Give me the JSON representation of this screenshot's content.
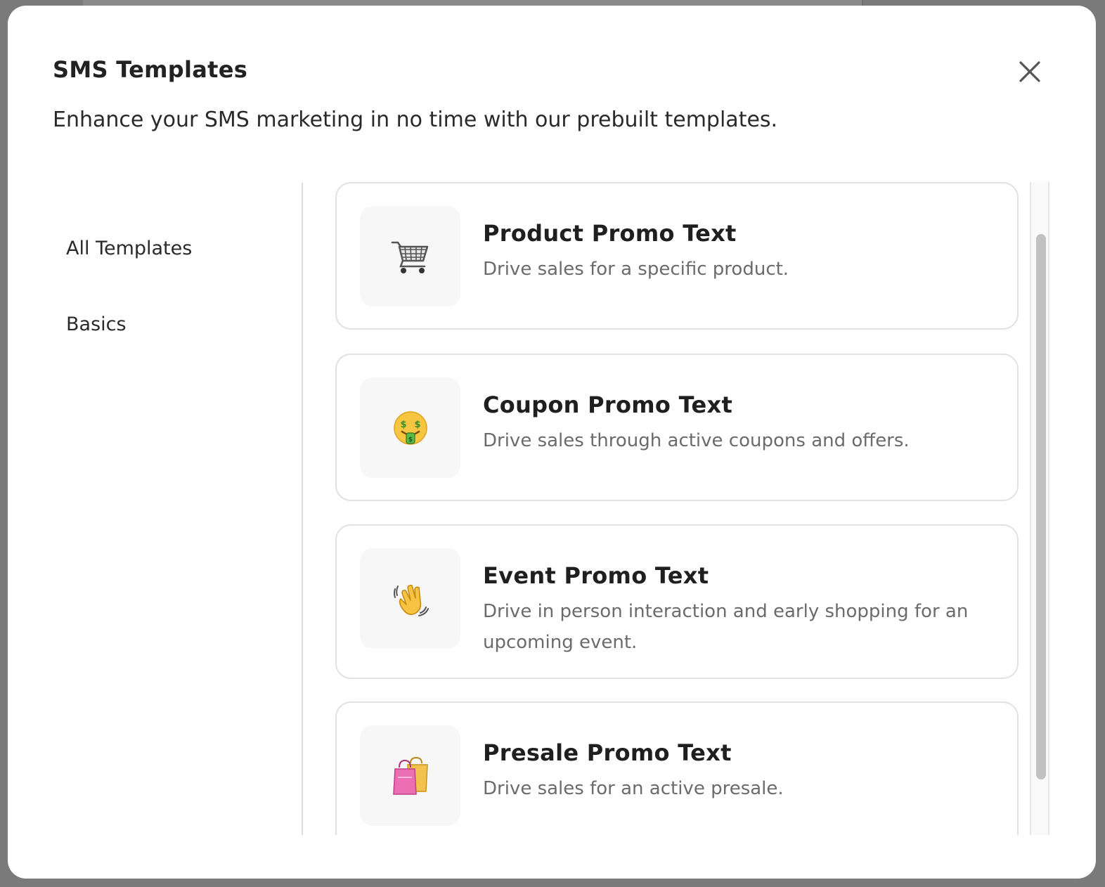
{
  "modal": {
    "title": "SMS Templates",
    "subtitle": "Enhance your SMS marketing in no time with our prebuilt templates."
  },
  "sidebar": {
    "items": [
      {
        "label": "All Templates"
      },
      {
        "label": "Basics"
      }
    ]
  },
  "templates": [
    {
      "icon": "shopping-cart-icon",
      "title": "Product Promo Text",
      "description": "Drive sales for a specific product."
    },
    {
      "icon": "money-mouth-face-icon",
      "title": "Coupon Promo Text",
      "description": "Drive sales through active coupons and offers."
    },
    {
      "icon": "waving-hand-icon",
      "title": "Event Promo Text",
      "description": "Drive in person interaction and early shopping for an upcoming event."
    },
    {
      "icon": "shopping-bags-icon",
      "title": "Presale Promo Text",
      "description": "Drive sales for an active presale."
    }
  ],
  "colors": {
    "overlay": "#7a7a7a",
    "title_text": "#222222",
    "description_text": "#6b6b6b",
    "card_border": "#e1e1e1",
    "icon_tile": "#f7f7f7"
  }
}
